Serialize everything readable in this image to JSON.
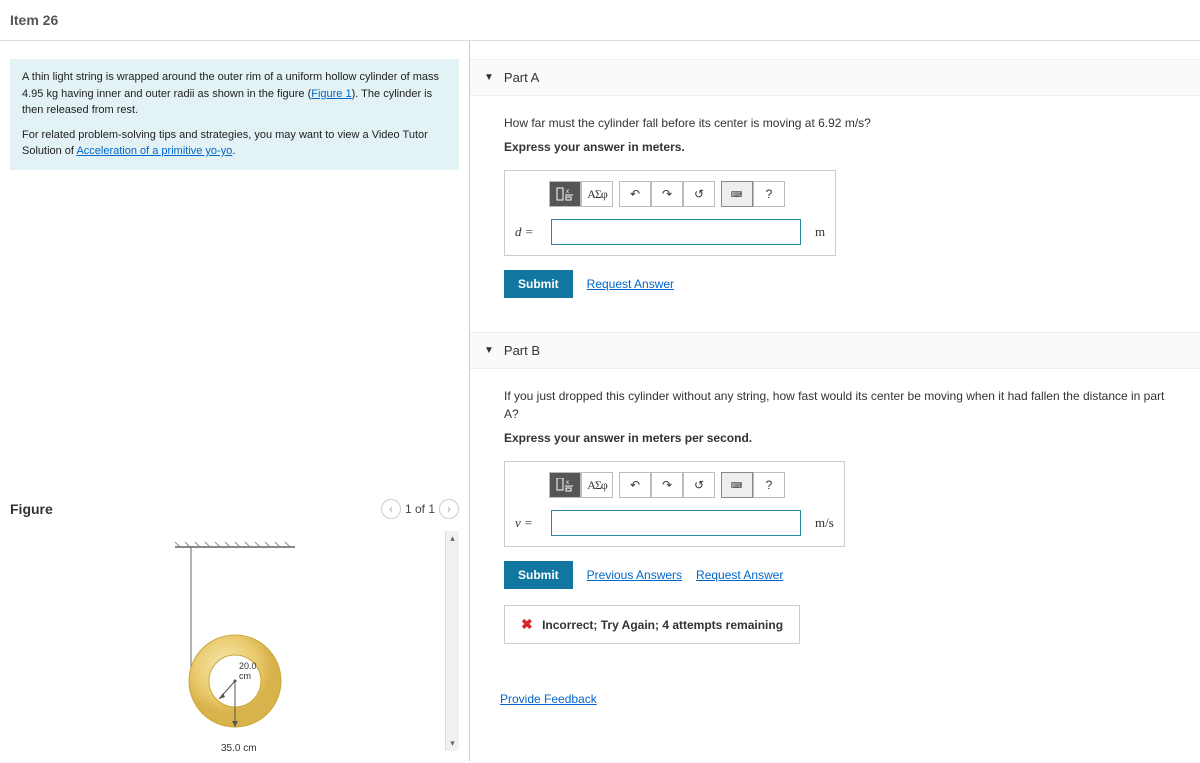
{
  "item_title": "Item 26",
  "problem": {
    "text_before_mass": "A thin light string is wrapped around the outer rim of a uniform hollow cylinder of mass ",
    "mass": "4.95 kg",
    "text_after_mass": " having inner and outer radii as shown in the figure (",
    "figure_link": "Figure 1",
    "text_after_link": "). The cylinder is then released from rest.",
    "tips_prefix": "For related problem-solving tips and strategies, you may want to view a Video Tutor Solution of ",
    "tips_link": "Acceleration of a primitive yo-yo",
    "tips_suffix": "."
  },
  "figure": {
    "title": "Figure",
    "pager": "1 of 1",
    "inner_radius_label": "20.0 cm",
    "outer_radius_label": "35.0 cm"
  },
  "parts": {
    "a": {
      "title": "Part A",
      "question": "How far must the cylinder fall before its center is moving at 6.92 m/s?",
      "instruction": "Express your answer in meters.",
      "var_label": "d =",
      "unit": "m",
      "submit": "Submit",
      "links": [
        "Request Answer"
      ]
    },
    "b": {
      "title": "Part B",
      "question": "If you just dropped this cylinder without any string, how fast would its center be moving when it had fallen the distance in part A?",
      "instruction": "Express your answer in meters per second.",
      "var_label": "v =",
      "unit": "m/s",
      "submit": "Submit",
      "links": [
        "Previous Answers",
        "Request Answer"
      ],
      "feedback": "Incorrect; Try Again; 4 attempts remaining"
    }
  },
  "toolbar": {
    "greek": "ΑΣφ"
  },
  "provide_feedback": "Provide Feedback"
}
